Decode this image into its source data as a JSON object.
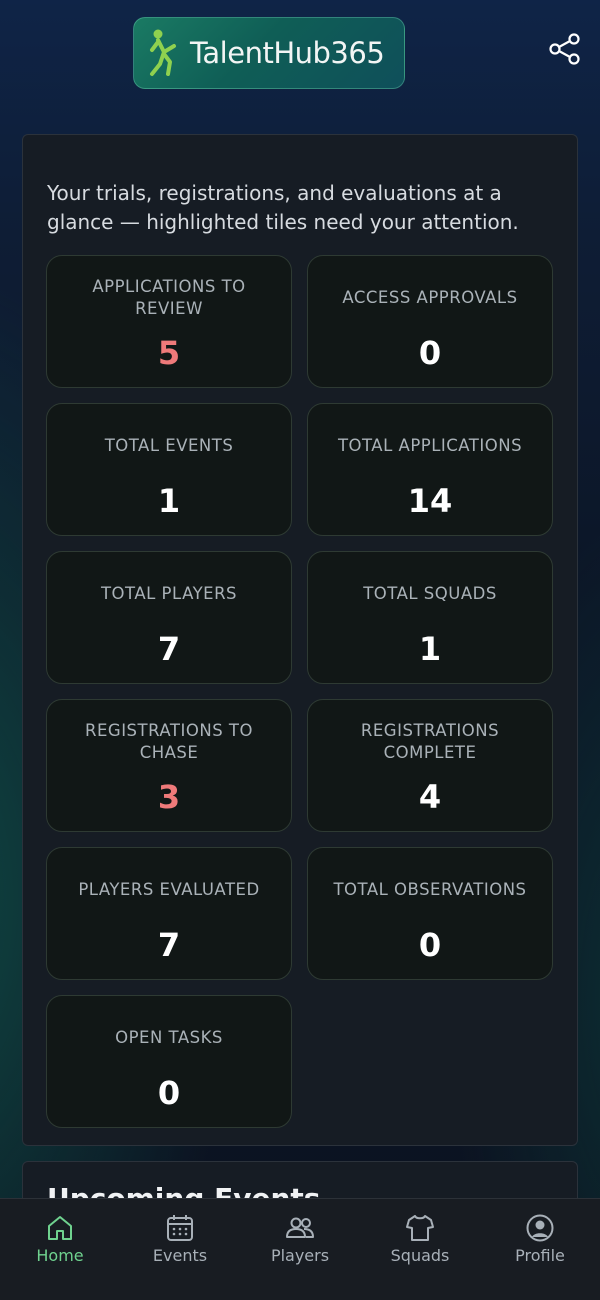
{
  "header": {
    "brand": "TalentHub365",
    "share_icon": "share-icon"
  },
  "summary": {
    "intro": "Your trials, registrations, and evaluations at a glance — highlighted tiles need your attention.",
    "tiles": [
      {
        "label": "APPLICATIONS TO REVIEW",
        "value": "5",
        "alert": true
      },
      {
        "label": "ACCESS APPROVALS",
        "value": "0",
        "alert": false
      },
      {
        "label": "TOTAL EVENTS",
        "value": "1",
        "alert": false
      },
      {
        "label": "TOTAL APPLICATIONS",
        "value": "14",
        "alert": false
      },
      {
        "label": "TOTAL PLAYERS",
        "value": "7",
        "alert": false
      },
      {
        "label": "TOTAL SQUADS",
        "value": "1",
        "alert": false
      },
      {
        "label": "REGISTRATIONS TO CHASE",
        "value": "3",
        "alert": true
      },
      {
        "label": "REGISTRATIONS COMPLETE",
        "value": "4",
        "alert": false
      },
      {
        "label": "PLAYERS EVALUATED",
        "value": "7",
        "alert": false
      },
      {
        "label": "TOTAL OBSERVATIONS",
        "value": "0",
        "alert": false
      },
      {
        "label": "OPEN TASKS",
        "value": "0",
        "alert": false
      }
    ]
  },
  "upcoming": {
    "title": "Upcoming Events"
  },
  "nav": {
    "items": [
      {
        "label": "Home",
        "icon": "home-icon",
        "active": true
      },
      {
        "label": "Events",
        "icon": "calendar-icon",
        "active": false
      },
      {
        "label": "Players",
        "icon": "players-icon",
        "active": false
      },
      {
        "label": "Squads",
        "icon": "shirt-icon",
        "active": false
      },
      {
        "label": "Profile",
        "icon": "profile-icon",
        "active": false
      }
    ]
  },
  "colors": {
    "accent": "#6fd28f",
    "alert": "#ef7a7a",
    "tile_bg": "#111716",
    "panel_bg": "#161c24"
  }
}
